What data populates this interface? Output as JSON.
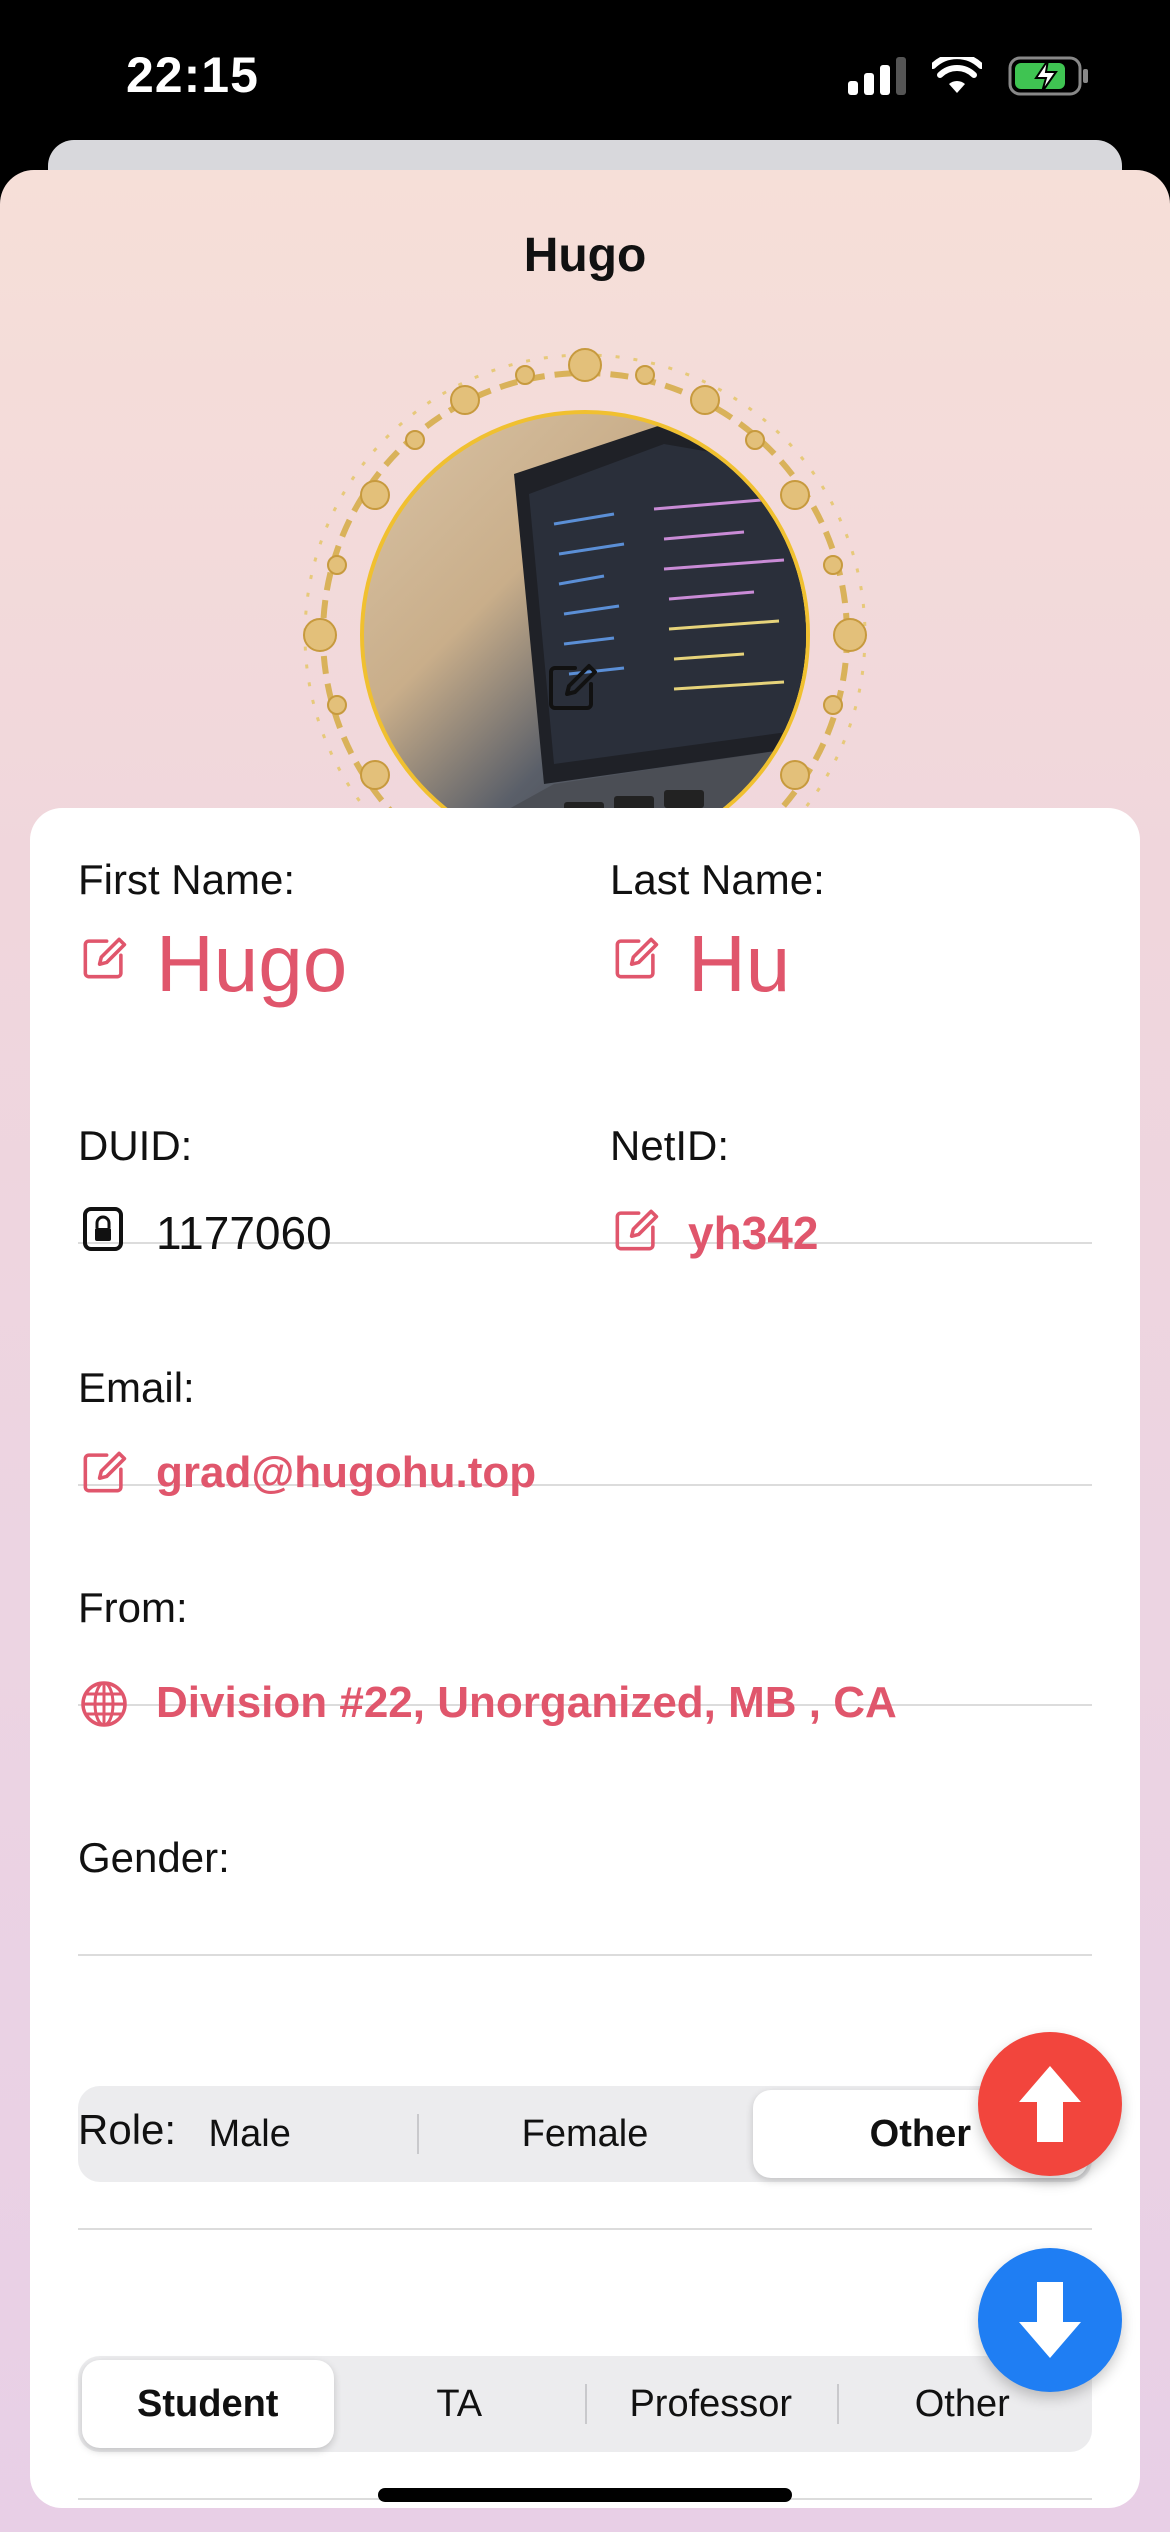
{
  "status_bar": {
    "time": "22:15",
    "icons": [
      "signal-icon",
      "wifi-icon",
      "battery-charging-icon"
    ]
  },
  "sheet": {
    "title": "Hugo"
  },
  "avatar": {
    "edit_icon": "square-pencil-icon"
  },
  "fields": {
    "first_name_label": "First Name:",
    "first_name_value": "Hugo",
    "last_name_label": "Last Name:",
    "last_name_value": "Hu",
    "duid_label": "DUID:",
    "duid_value": "1177060",
    "netid_label": "NetID:",
    "netid_value": "yh342",
    "email_label": "Email:",
    "email_value": "grad@hugohu.top",
    "from_label": "From:",
    "from_value": "Division #22, Unorganized, MB , CA"
  },
  "gender": {
    "label": "Gender:",
    "options": [
      "Male",
      "Female",
      "Other"
    ],
    "selected": "Other"
  },
  "role": {
    "label": "Role:",
    "options": [
      "Student",
      "TA",
      "Professor",
      "Other"
    ],
    "selected": "Student"
  },
  "colors": {
    "accent_pink": "#e0566c",
    "fab_up": "#f2453d",
    "fab_down": "#1f7ef3"
  },
  "fab": {
    "up_icon": "arrow-up-icon",
    "down_icon": "arrow-down-icon"
  }
}
